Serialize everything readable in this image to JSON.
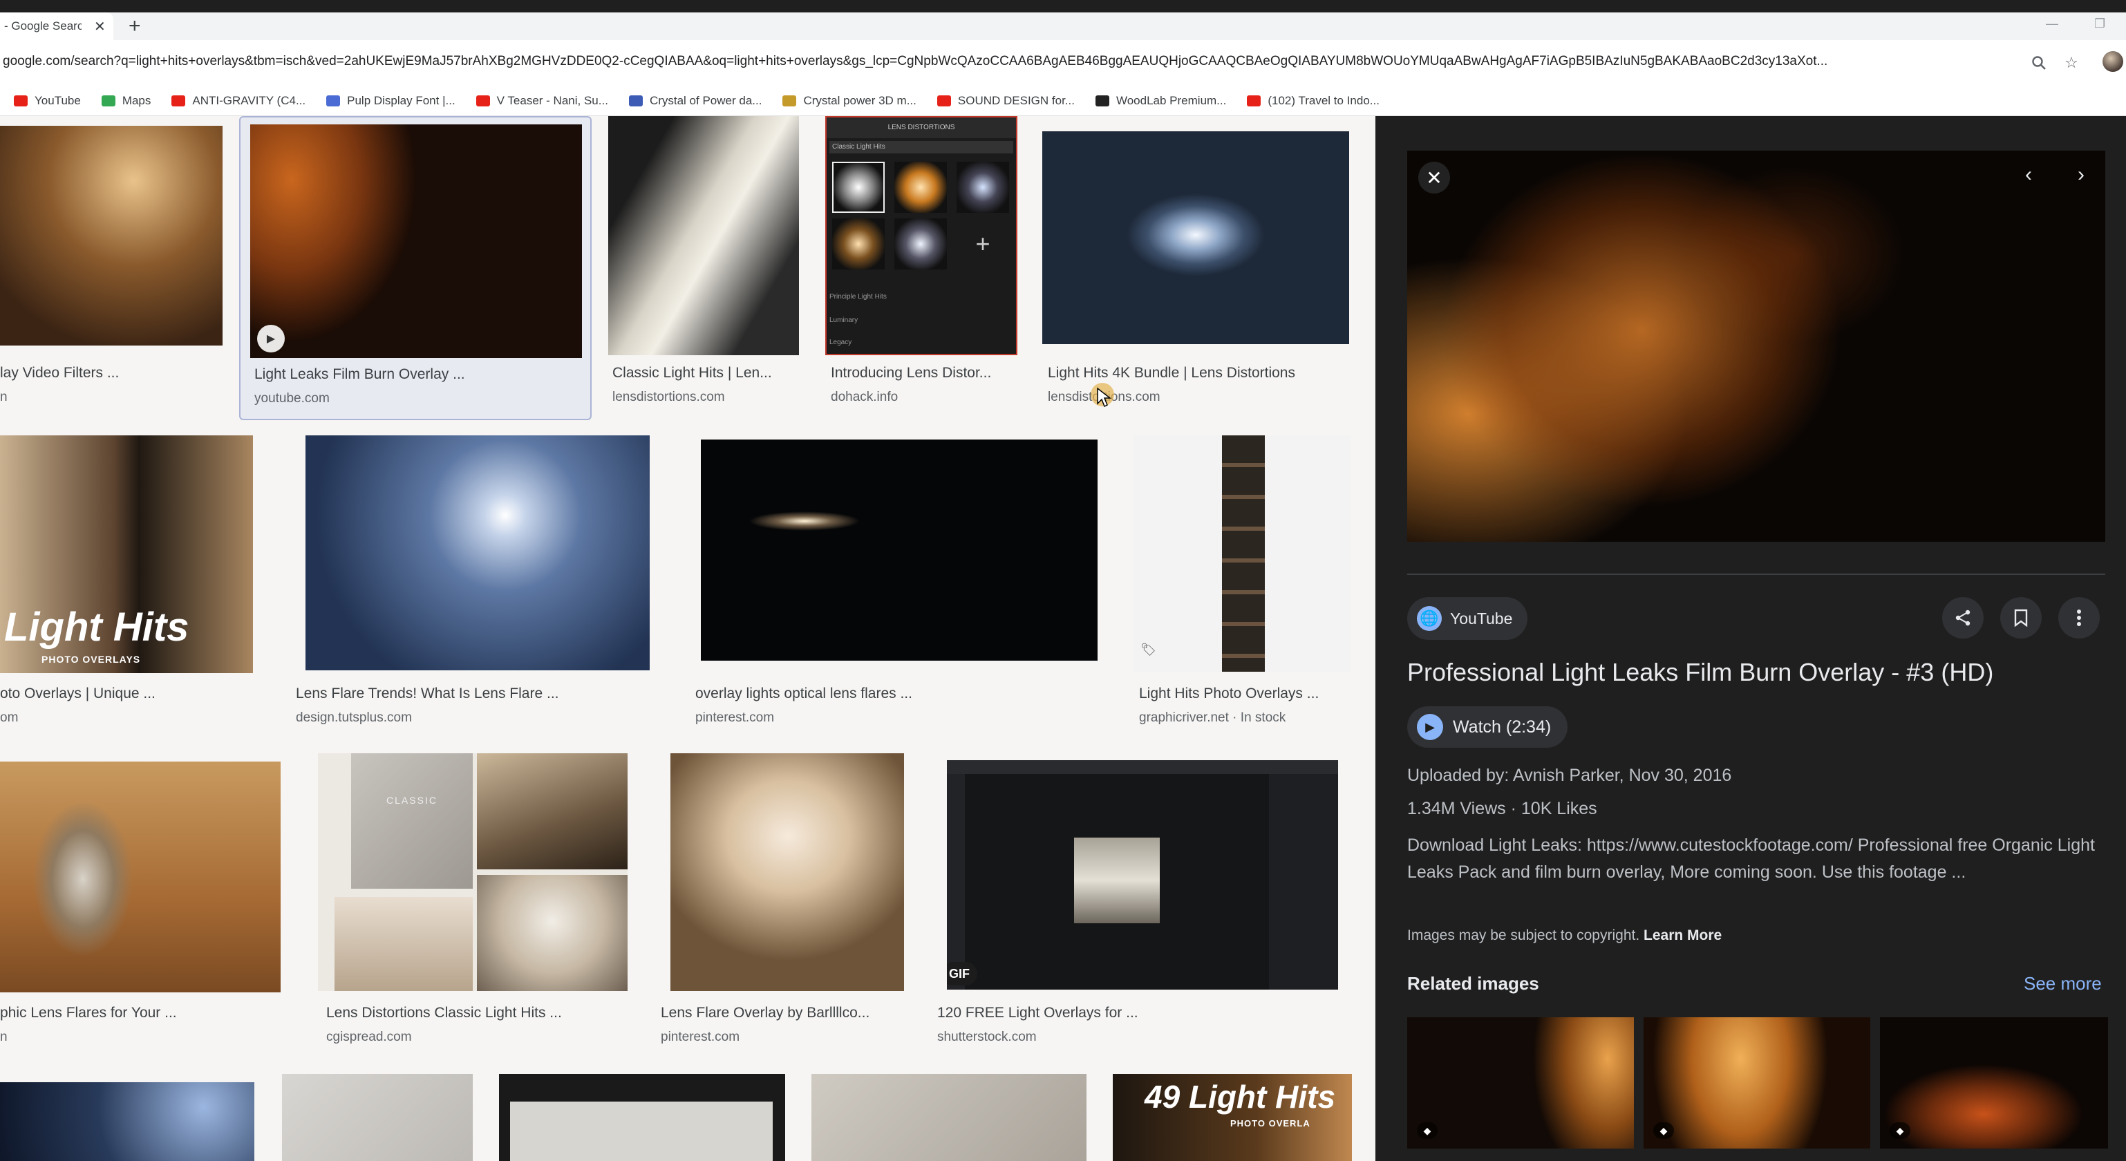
{
  "browser": {
    "tab_title": "- Google Searc",
    "tab_close": "✕",
    "new_tab": "+",
    "url": "google.com/search?q=light+hits+overlays&tbm=isch&ved=2ahUKEwjE9MaJ57brAhXBg2MGHVzDDE0Q2-cCegQIABAA&oq=light+hits+overlays&gs_lcp=CgNpbWcQAzoCCAA6BAgAEB46BggAEAUQHjoGCAAQCBAeOgQIABAYUM8bWOUoYMUqaABwAHgAgAF7iAGpB5IBAzIuN5gBAKABAaoBC2d3cy13aXot...",
    "icons": [
      "zoom-icon",
      "star-icon"
    ]
  },
  "bookmarks": [
    {
      "label": "YouTube",
      "color": "#e62117"
    },
    {
      "label": "Maps",
      "color": "#34a853"
    },
    {
      "label": "ANTI-GRAVITY (C4...",
      "color": "#e62117"
    },
    {
      "label": "Pulp Display Font |...",
      "color": "#4a6bd4"
    },
    {
      "label": "V Teaser - Nani, Su...",
      "color": "#e62117"
    },
    {
      "label": "Crystal of Power da...",
      "color": "#3b5bb5"
    },
    {
      "label": "Crystal power 3D m...",
      "color": "#c49a2a"
    },
    {
      "label": "SOUND DESIGN for...",
      "color": "#e62117"
    },
    {
      "label": "WoodLab Premium...",
      "color": "#222222"
    },
    {
      "label": "(102) Travel to Indo...",
      "color": "#e62117"
    }
  ],
  "results": [
    {
      "title": "lay Video Filters ...",
      "source": "n"
    },
    {
      "title": "Light Leaks Film Burn Overlay ...",
      "source": "youtube.com"
    },
    {
      "title": "Classic Light Hits | Len...",
      "source": "lensdistortions.com"
    },
    {
      "title": "Introducing Lens Distor...",
      "source": "dohack.info"
    },
    {
      "title": "Light Hits 4K Bundle | Lens Distortions",
      "source": "lensdistortions.com"
    },
    {
      "title": "oto Overlays | Unique ...",
      "source": "om"
    },
    {
      "title": "Lens Flare Trends! What Is Lens Flare ...",
      "source": "design.tutsplus.com"
    },
    {
      "title": "overlay lights optical lens flares ...",
      "source": "pinterest.com"
    },
    {
      "title": "Light Hits Photo Overlays ...",
      "source": "graphicriver.net · In stock"
    },
    {
      "title": "phic Lens Flares for Your ...",
      "source": "n"
    },
    {
      "title": "Lens Distortions Classic Light Hits ...",
      "source": "cgispread.com"
    },
    {
      "title": "Lens Flare Overlay by Barllllco...",
      "source": "pinterest.com"
    },
    {
      "title": "120 FREE Light Overlays for ...",
      "source": "shutterstock.com"
    }
  ],
  "thumb_text": {
    "lighthits_brand": "Light Hits",
    "lighthits_sub": "PHOTO OVERLAYS",
    "lighthits_brand2": "49 Light Hits",
    "lighthits_sub2": "PHOTO OVERLA",
    "gif_badge": "GIF",
    "lens_header": "LENS DISTORTIONS",
    "lens_row1": "Classic Light Hits",
    "lens_row2": "Principle Light Hits",
    "lens_row3": "Luminary",
    "lens_row4": "Legacy",
    "classic_box": "CLASSIC"
  },
  "panel": {
    "close": "✕",
    "prev": "‹",
    "next": "›",
    "source": "YouTube",
    "title": "Professional Light Leaks Film Burn Overlay - #3 (HD)",
    "watch": "Watch (2:34)",
    "uploaded": "Uploaded by: Avnish Parker, Nov 30, 2016",
    "stats": "1.34M Views · 10K Likes",
    "description": "Download Light Leaks: https://www.cutestockfootage.com/ Professional free Organic Light Leaks Pack and film burn overlay, More coming soon. Use this footage ...",
    "copyright": "Images may be subject to copyright.",
    "learn_more": "Learn More",
    "related_heading": "Related images",
    "see_more": "See more",
    "share_icon": "share-icon",
    "save_icon": "bookmark-icon",
    "more_icon": "more-vert-icon"
  }
}
